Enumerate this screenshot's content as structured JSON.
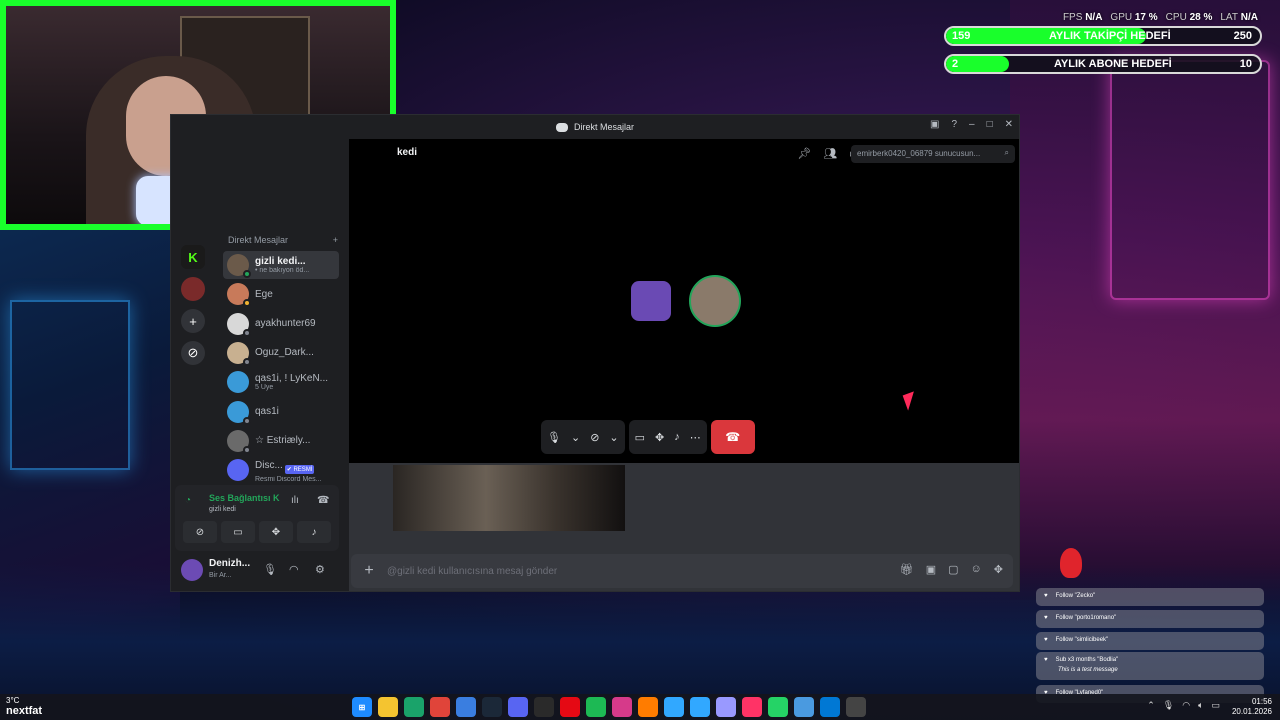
{
  "stats": {
    "fps_label": "FPS",
    "fps": "N/A",
    "gpu_label": "GPU",
    "gpu": "17 %",
    "cpu_label": "CPU",
    "cpu": "28 %",
    "lat_label": "LAT",
    "lat": "N/A"
  },
  "goals": [
    {
      "current": "159",
      "title": "AYLIK TAKİPÇİ HEDEFİ",
      "target": "250",
      "fill_percent": 63.6
    },
    {
      "current": "2",
      "title": "AYLIK ABONE HEDEFİ",
      "target": "10",
      "fill_percent": 20
    }
  ],
  "discord": {
    "window_title": "Direkt Mesajlar",
    "channel_title": "kedi",
    "search_placeholder": "emirberk0420_06879 sunucusun...",
    "dm_header": "Direkt Mesajlar",
    "dm_add": "+",
    "dms": [
      {
        "name": "gizli kedi...",
        "sub": "• ne bakıyon öd...",
        "status": "on",
        "color": "#6b5a4a"
      },
      {
        "name": "Ege",
        "sub": "",
        "status": "idle",
        "color": "#c87a5a"
      },
      {
        "name": "ayakhunter69",
        "sub": "",
        "status": "off",
        "color": "#d8d8d8"
      },
      {
        "name": "Oguz_Dark...",
        "sub": "",
        "status": "off",
        "color": "#c8b090"
      },
      {
        "name": "qas1i, ! LyKeN...",
        "sub": "5 Üye",
        "status": "",
        "color": "#3a9ad8"
      },
      {
        "name": "qas1i",
        "sub": "",
        "status": "off",
        "color": "#3a9ad8"
      },
      {
        "name": "☆ Estriæly...",
        "sub": "",
        "status": "off",
        "color": "#6a6a6a"
      },
      {
        "name": "Disc...",
        "sub": "Resmi Discord Mes...",
        "status": "",
        "color": "#5865f2",
        "badge": "✔ RESMİ"
      }
    ],
    "voice": {
      "status": "Ses Bağlantısı K",
      "channel": "gizli kedi"
    },
    "user": {
      "name": "Denizh...",
      "status": "Bir Ar..."
    },
    "message_placeholder": "@gizli kedi kullanıcısına mesaj gönder"
  },
  "events": [
    {
      "text": "Follow \"Zecko\""
    },
    {
      "text": "Follow \"porto1romano\""
    },
    {
      "text": "Follow \"simlicibeek\""
    },
    {
      "text": "Sub x3 months \"Bodlia\"",
      "note": "This is a test message"
    },
    {
      "text": "Follow \"Lyfaned0\""
    }
  ],
  "taskbar": {
    "weather_temp": "3°C",
    "weather_user": "nextfat",
    "time": "01:56",
    "date": "20.01.2026"
  },
  "colors": {
    "accent_green": "#19ff2b",
    "discord_blurple": "#5865f2",
    "hangup_red": "#da373c"
  }
}
